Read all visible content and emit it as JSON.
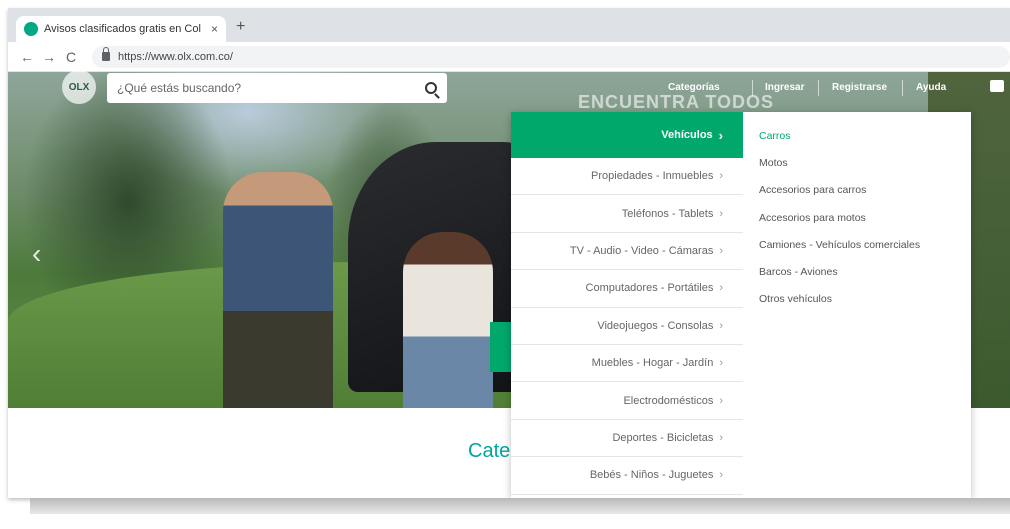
{
  "browser": {
    "tab_title": "Avisos clasificados gratis en Col",
    "tab_close": "×",
    "new_tab": "+",
    "url": "https://www.olx.com.co/",
    "back": "←",
    "forward": "→",
    "reload": "C"
  },
  "header": {
    "logo": "OLX",
    "search_placeholder": "¿Qué estás buscando?",
    "nav": [
      "Categorías",
      "Ingresar",
      "Registrarse",
      "Ayuda"
    ],
    "headline": "ENCUENTRA TODOS"
  },
  "hero": {
    "prev_arrow": "‹"
  },
  "menu": {
    "categories": [
      {
        "label": "Vehículos",
        "active": true
      },
      {
        "label": "Propiedades - Inmuebles",
        "active": false
      },
      {
        "label": "Teléfonos - Tablets",
        "active": false
      },
      {
        "label": "TV - Audio - Video - Cámaras",
        "active": false
      },
      {
        "label": "Computadores - Portátiles",
        "active": false
      },
      {
        "label": "Videojuegos - Consolas",
        "active": false
      },
      {
        "label": "Muebles - Hogar - Jardín",
        "active": false
      },
      {
        "label": "Electrodomésticos",
        "active": false
      },
      {
        "label": "Deportes - Bicicletas",
        "active": false
      },
      {
        "label": "Bebés - Niños - Juguetes",
        "active": false
      }
    ],
    "subcategories": [
      {
        "label": "Carros",
        "active": true
      },
      {
        "label": "Motos",
        "active": false
      },
      {
        "label": "Accesorios para carros",
        "active": false
      },
      {
        "label": "Accesorios para motos",
        "active": false
      },
      {
        "label": "Camiones - Vehículos comerciales",
        "active": false
      },
      {
        "label": "Barcos - Aviones",
        "active": false
      },
      {
        "label": "Otros vehículos",
        "active": false
      }
    ]
  },
  "content": {
    "section_title": "Cate"
  },
  "colors": {
    "brand_green": "#00a86b",
    "title_teal": "#00a5a0"
  }
}
